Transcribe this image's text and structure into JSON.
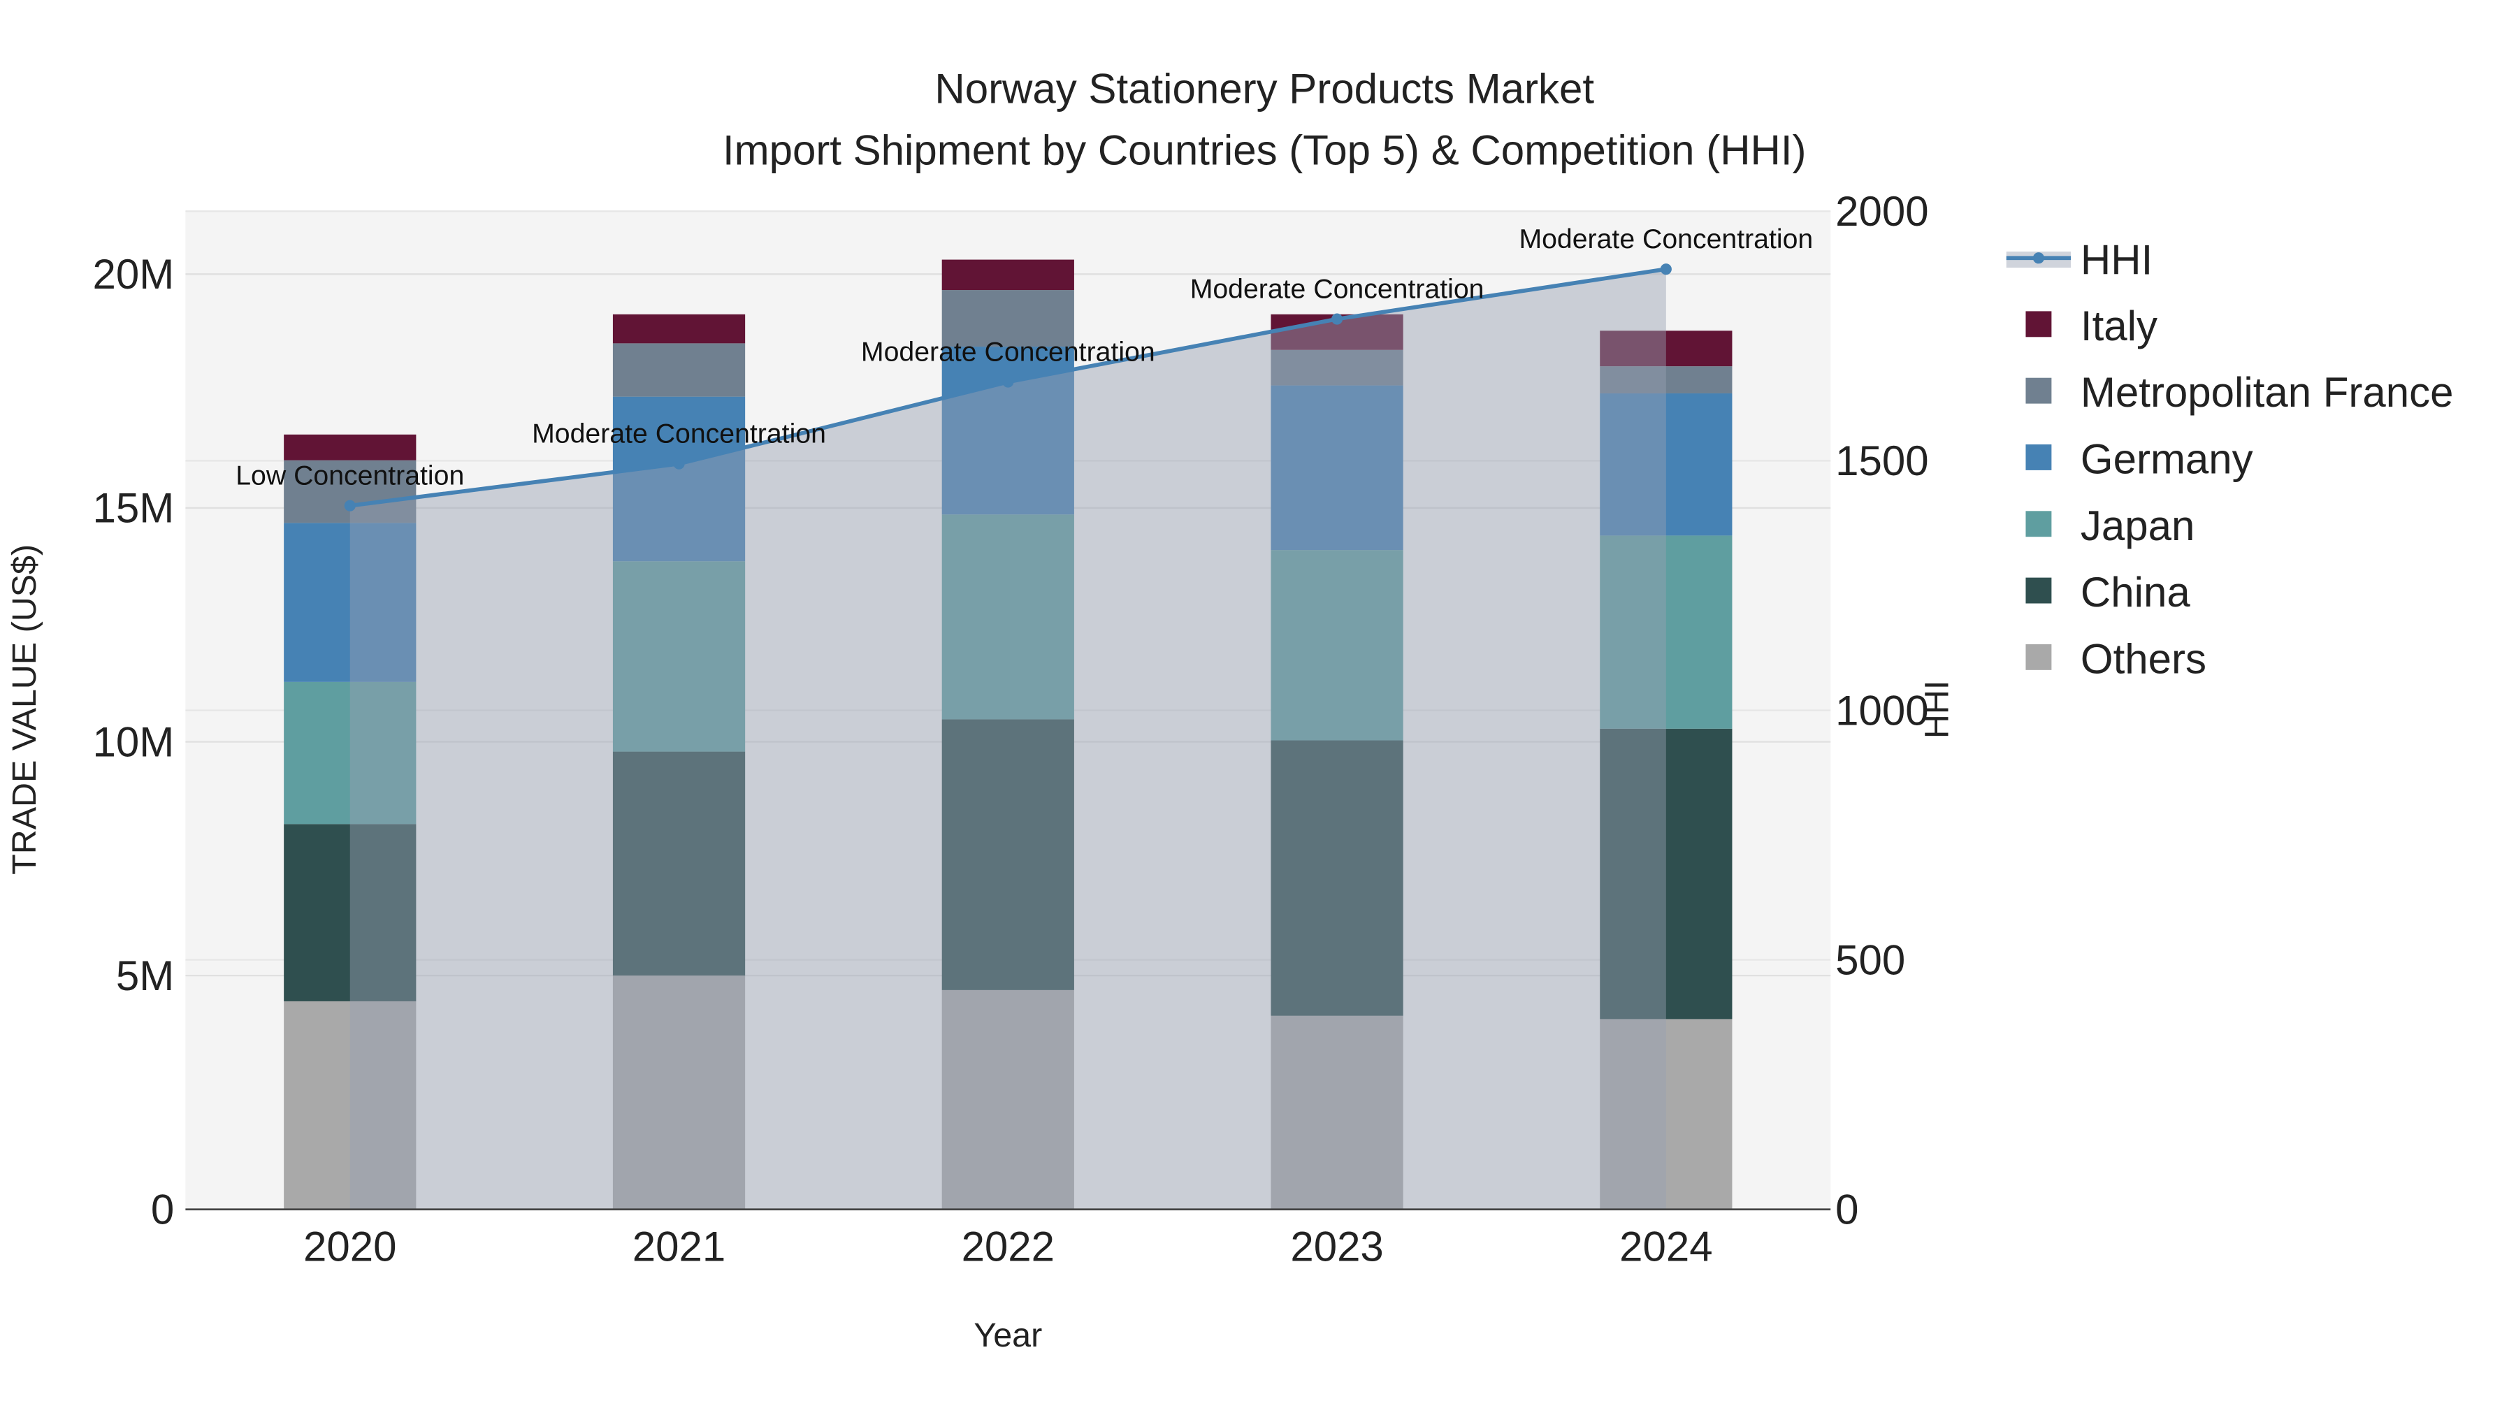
{
  "chart_data": {
    "type": "bar",
    "stacked": true,
    "title": "Norway Stationery Products Market",
    "subtitle": "Import Shipment by Countries (Top 5) & Competition (HHI)",
    "xlabel": "Year",
    "ylabel": "TRADE VALUE (US$)",
    "y2label": "HHI",
    "categories": [
      "2020",
      "2021",
      "2022",
      "2023",
      "2024"
    ],
    "ylim": [
      0,
      21300000
    ],
    "yticks": [
      0,
      5000000,
      10000000,
      15000000,
      20000000
    ],
    "ytick_labels": [
      "0",
      "5M",
      "10M",
      "15M",
      "20M"
    ],
    "y2lim": [
      0,
      2000
    ],
    "y2ticks": [
      0,
      500,
      1000,
      1500,
      2000
    ],
    "y2tick_labels": [
      "0",
      "500",
      "1000",
      "1500",
      "2000"
    ],
    "series": [
      {
        "name": "Others",
        "color": "#a9a9a9",
        "values": [
          4450000,
          5000000,
          4690000,
          4140000,
          4070000
        ]
      },
      {
        "name": "China",
        "color": "#2f4f4f",
        "values": [
          3790000,
          4790000,
          5790000,
          5890000,
          6210000
        ]
      },
      {
        "name": "Japan",
        "color": "#5f9ea0",
        "values": [
          3040000,
          4070000,
          4380000,
          4070000,
          4130000
        ]
      },
      {
        "name": "Germany",
        "color": "#4682b4",
        "values": [
          3400000,
          3520000,
          3590000,
          3520000,
          3040000
        ]
      },
      {
        "name": "Metropolitan France",
        "color": "#708090",
        "values": [
          1340000,
          1140000,
          1210000,
          760000,
          580000
        ]
      },
      {
        "name": "Italy",
        "color": "#611435",
        "values": [
          550000,
          620000,
          650000,
          760000,
          760000
        ]
      }
    ],
    "line": {
      "name": "HHI",
      "color": "#4682b4",
      "values": [
        1410,
        1494,
        1658,
        1784,
        1884
      ],
      "annotations": [
        "Low Concentration",
        "Moderate Concentration",
        "Moderate Concentration",
        "Moderate Concentration",
        "Moderate Concentration"
      ]
    },
    "legend": {
      "placement": "right",
      "order": [
        "HHI",
        "Italy",
        "Metropolitan France",
        "Germany",
        "Japan",
        "China",
        "Others"
      ]
    },
    "grid": true
  }
}
